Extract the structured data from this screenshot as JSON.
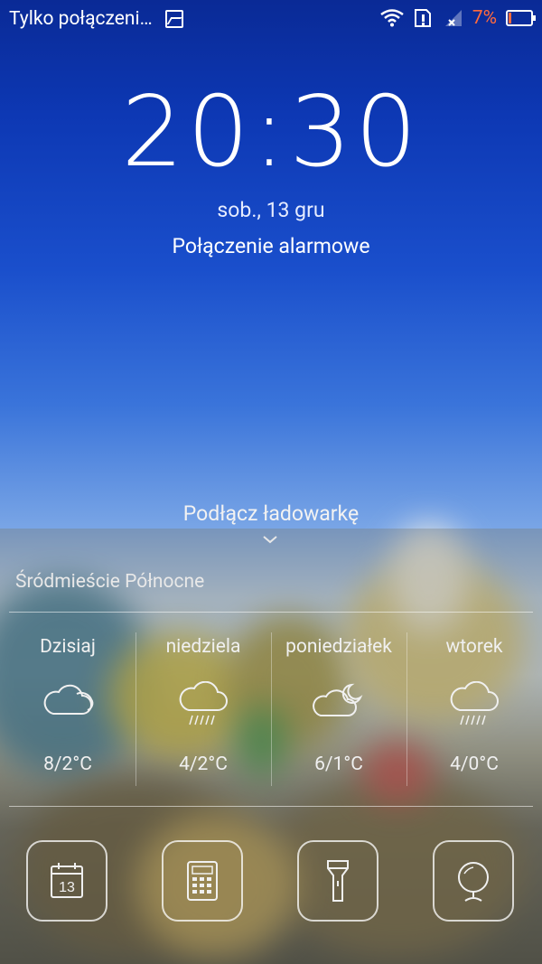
{
  "status_bar": {
    "carrier_text": "Tylko połączeni…",
    "battery_percent": "7%",
    "icons": [
      "image-icon",
      "wifi-icon",
      "sim-alert-icon",
      "signal-icon",
      "battery-icon"
    ]
  },
  "lock": {
    "time": "20:30",
    "date": "sob., 13 gru",
    "emergency_label": "Połączenie alarmowe",
    "charge_hint": "Podłącz ładowarkę"
  },
  "weather": {
    "location": "Śródmieście Północne",
    "days": [
      {
        "name": "Dzisiaj",
        "icon": "cloudy-icon",
        "temp": "8/2°C"
      },
      {
        "name": "niedziela",
        "icon": "rain-icon",
        "temp": "4/2°C"
      },
      {
        "name": "poniedziałek",
        "icon": "cloudy-night-icon",
        "temp": "6/1°C"
      },
      {
        "name": "wtorek",
        "icon": "rain-icon",
        "temp": "4/0°C"
      }
    ]
  },
  "shortcuts": [
    {
      "name": "calendar",
      "icon": "calendar-icon",
      "label": "13"
    },
    {
      "name": "calculator",
      "icon": "calculator-icon"
    },
    {
      "name": "flashlight",
      "icon": "flashlight-icon"
    },
    {
      "name": "mirror",
      "icon": "mirror-icon"
    }
  ],
  "colors": {
    "battery_low": "#ff6a3d",
    "sky_top": "#0a2a96"
  }
}
